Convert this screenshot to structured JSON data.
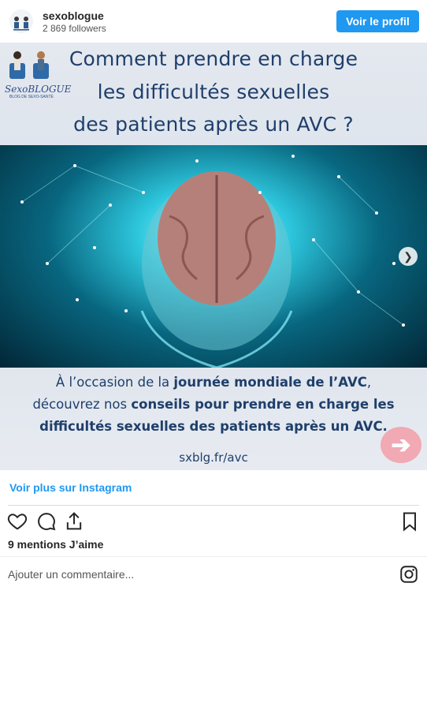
{
  "header": {
    "username": "sexoblogue",
    "followers": "2 869 followers",
    "profile_button": "Voir le profil"
  },
  "post": {
    "logo_text": "SexoBLOGUE",
    "logo_sub": "BLOG DE SEXO-SANTÉ",
    "title_lines": [
      "Comment prendre en charge",
      "les difficultés sexuelles",
      "des patients après un AVC ?"
    ],
    "caption_line1_normal": "À l’occasion de la ",
    "caption_line1_bold": "journée mondiale de l’AVC",
    "caption_line1_end": ",",
    "caption_line2_normal": "découvrez nos ",
    "caption_line2_bold": "conseils pour prendre en charge les",
    "caption_line3_bold": "difficultés sexuelles des patients après un AVC.",
    "url": "sxblg.fr/avc",
    "next_small_icon": "chevron-right-icon",
    "next_big_icon": "arrow-right-icon",
    "colors": {
      "title": "#1f3f6b",
      "accent_pink": "#f1a9b4",
      "brain_glow": "#2dc7dd"
    }
  },
  "footer": {
    "more_link": "Voir plus sur Instagram",
    "likes": "9 mentions J’aime",
    "comment_placeholder": "Ajouter un commentaire...",
    "action_icons": [
      "heart-icon",
      "comment-icon",
      "share-icon",
      "bookmark-icon",
      "instagram-icon"
    ],
    "link_color": "#1f98f2"
  }
}
